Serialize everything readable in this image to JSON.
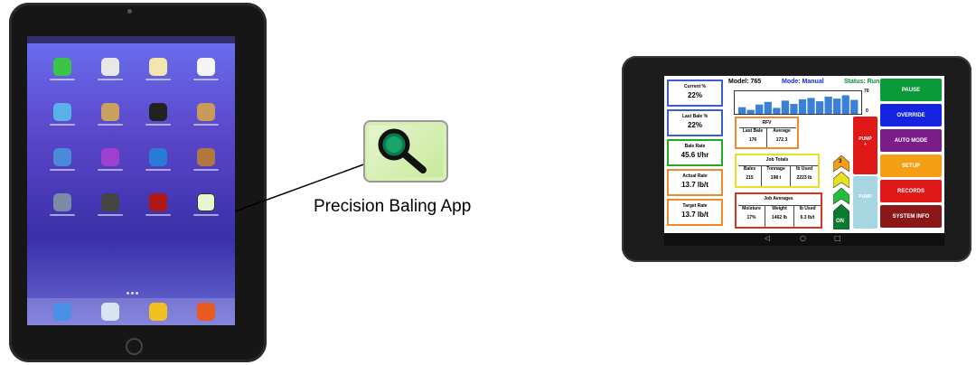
{
  "caption": "Precision Baling App",
  "tablet": {
    "header": {
      "model": "Model: 765",
      "mode": "Mode: Manual",
      "status": "Status: Run"
    },
    "chart": {
      "ymax_label": "70",
      "ymin_label": "0",
      "bars": [
        10,
        6,
        14,
        18,
        9,
        20,
        15,
        22,
        24,
        19,
        26,
        23,
        28,
        21
      ]
    },
    "stats": [
      {
        "label": "Current %",
        "value": "22%",
        "border": "#3a5fcd"
      },
      {
        "label": "Last Bale %",
        "value": "22%",
        "border": "#3a5fcd"
      },
      {
        "label": "Bale Rate",
        "value": "45.6 t/hr",
        "border": "#22aa22"
      },
      {
        "label": "Actual Rate",
        "value": "13.7 lb/t",
        "border": "#f08a28"
      },
      {
        "label": "Target Rate",
        "value": "13.7 lb/t",
        "border": "#f08a28"
      }
    ],
    "rfv": {
      "title": "RFV",
      "headers": [
        "Last Bale",
        "Average"
      ],
      "values": [
        "176",
        "172.3"
      ],
      "border": "#f08a28"
    },
    "job_totals": {
      "title": "Job Totals",
      "headers": [
        "Bales",
        "Tonnage",
        "lb Used"
      ],
      "values": [
        "215",
        "198 t",
        "2223 lb"
      ],
      "border": "#e8e020"
    },
    "job_averages": {
      "title": "Job Averages",
      "headers": [
        "Moisture",
        "Weight",
        "lb Used"
      ],
      "values": [
        "17%",
        "1462 lb",
        "6.3 lb/t"
      ],
      "border": "#e03020"
    },
    "pump_plus": {
      "label": "PUMP",
      "sign": "+"
    },
    "pump_minus": {
      "label": "PUMP",
      "sign": "-"
    },
    "gauge": {
      "level_label": "3",
      "on_label": "ON"
    },
    "menu": [
      {
        "label": "PAUSE",
        "color": "#0b9a3a"
      },
      {
        "label": "OVERRIDE",
        "color": "#1424e0"
      },
      {
        "label": "AUTO MODE",
        "color": "#7a1c8a"
      },
      {
        "label": "SETUP",
        "color": "#f5a014"
      },
      {
        "label": "RECORDS",
        "color": "#e01818"
      },
      {
        "label": "SYSTEM INFO",
        "color": "#8a1818"
      }
    ],
    "nav": {
      "back": "◁",
      "home": "○",
      "recent": "□"
    }
  }
}
